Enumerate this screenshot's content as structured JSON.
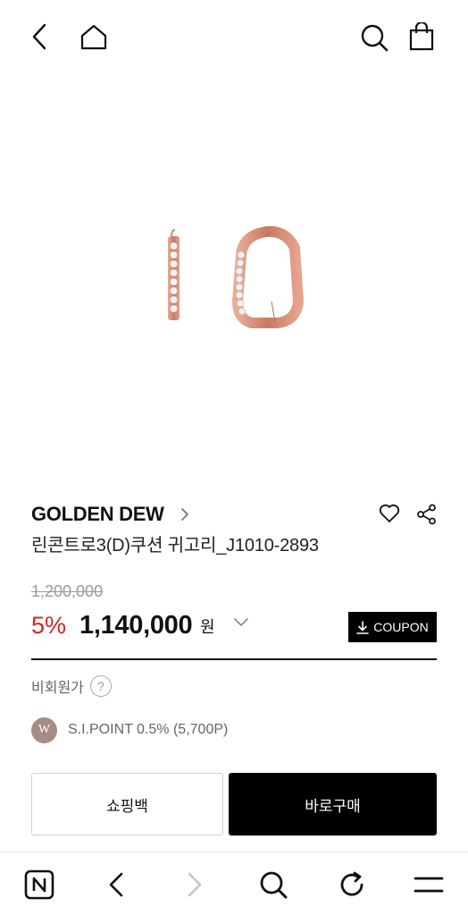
{
  "header": {
    "icons": [
      "back-icon",
      "home-icon",
      "search-icon",
      "shopping-bag-icon"
    ]
  },
  "product": {
    "image_alt": "rose gold huggie earrings with cubic stones",
    "brand": "GOLDEN DEW",
    "name": "린콘트로3(D)쿠션 귀고리_J1010-2893",
    "original_price": "1,200,000",
    "discount": "5%",
    "sale_price": "1,140,000",
    "currency": "원",
    "coupon_label": "COUPON",
    "nonmember_label": "비회원가",
    "help_label": "?",
    "points_badge": "W",
    "points_text": "S.I.POINT 0.5% (5,700P)"
  },
  "actions": {
    "shopping_bag": "쇼핑백",
    "buy_now": "바로구매"
  },
  "browser_bar": {
    "icons": [
      "naver-icon",
      "back-arrow-icon",
      "forward-arrow-icon",
      "search-icon",
      "refresh-icon",
      "menu-icon"
    ]
  },
  "colors": {
    "discount": "#d9251d",
    "rose_gold": "#d9927c",
    "points_badge": "#a58d83",
    "primary_button": "#000000"
  }
}
